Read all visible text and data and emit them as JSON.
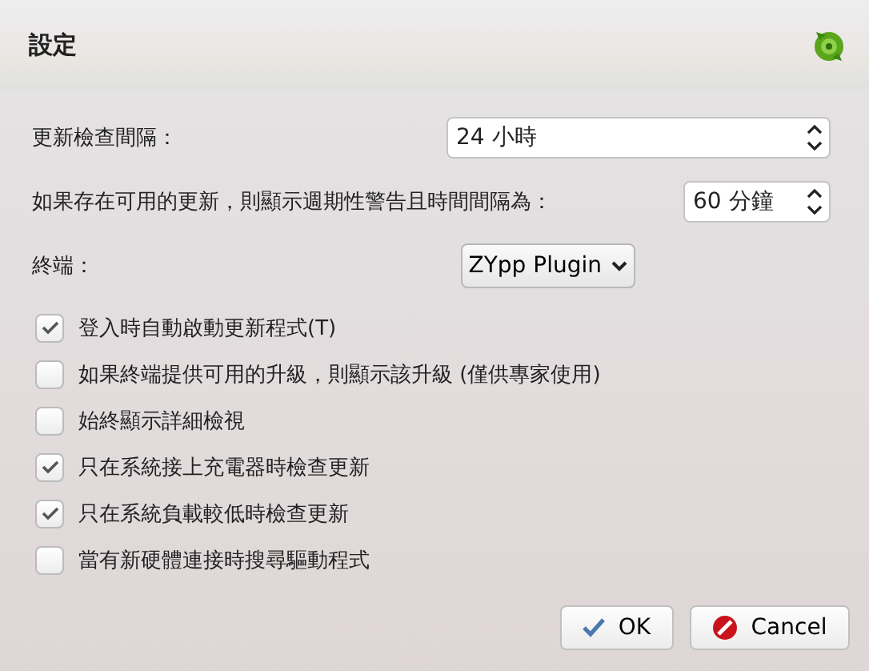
{
  "title": "設定",
  "fields": [
    {
      "kind": "spin",
      "label": "更新檢查間隔：",
      "value": "24 小時"
    },
    {
      "kind": "spin",
      "label": "如果存在可用的更新，則顯示週期性警告且時間間隔為：",
      "value": "60 分鐘"
    },
    {
      "kind": "combo",
      "label": "終端：",
      "value": "ZYpp Plugin"
    }
  ],
  "options": [
    {
      "label": "登入時自動啟動更新程式(T)",
      "checked": true
    },
    {
      "label": "如果終端提供可用的升級，則顯示該升級 (僅供專家使用)",
      "checked": false
    },
    {
      "label": "始終顯示詳細檢視",
      "checked": false
    },
    {
      "label": "只在系統接上充電器時檢查更新",
      "checked": true
    },
    {
      "label": "只在系統負載較低時檢查更新",
      "checked": true
    },
    {
      "label": "當有新硬體連接時搜尋驅動程式",
      "checked": false
    }
  ],
  "buttons": [
    {
      "kind": "ok",
      "label": "OK"
    },
    {
      "kind": "cancel",
      "label": "Cancel"
    }
  ]
}
